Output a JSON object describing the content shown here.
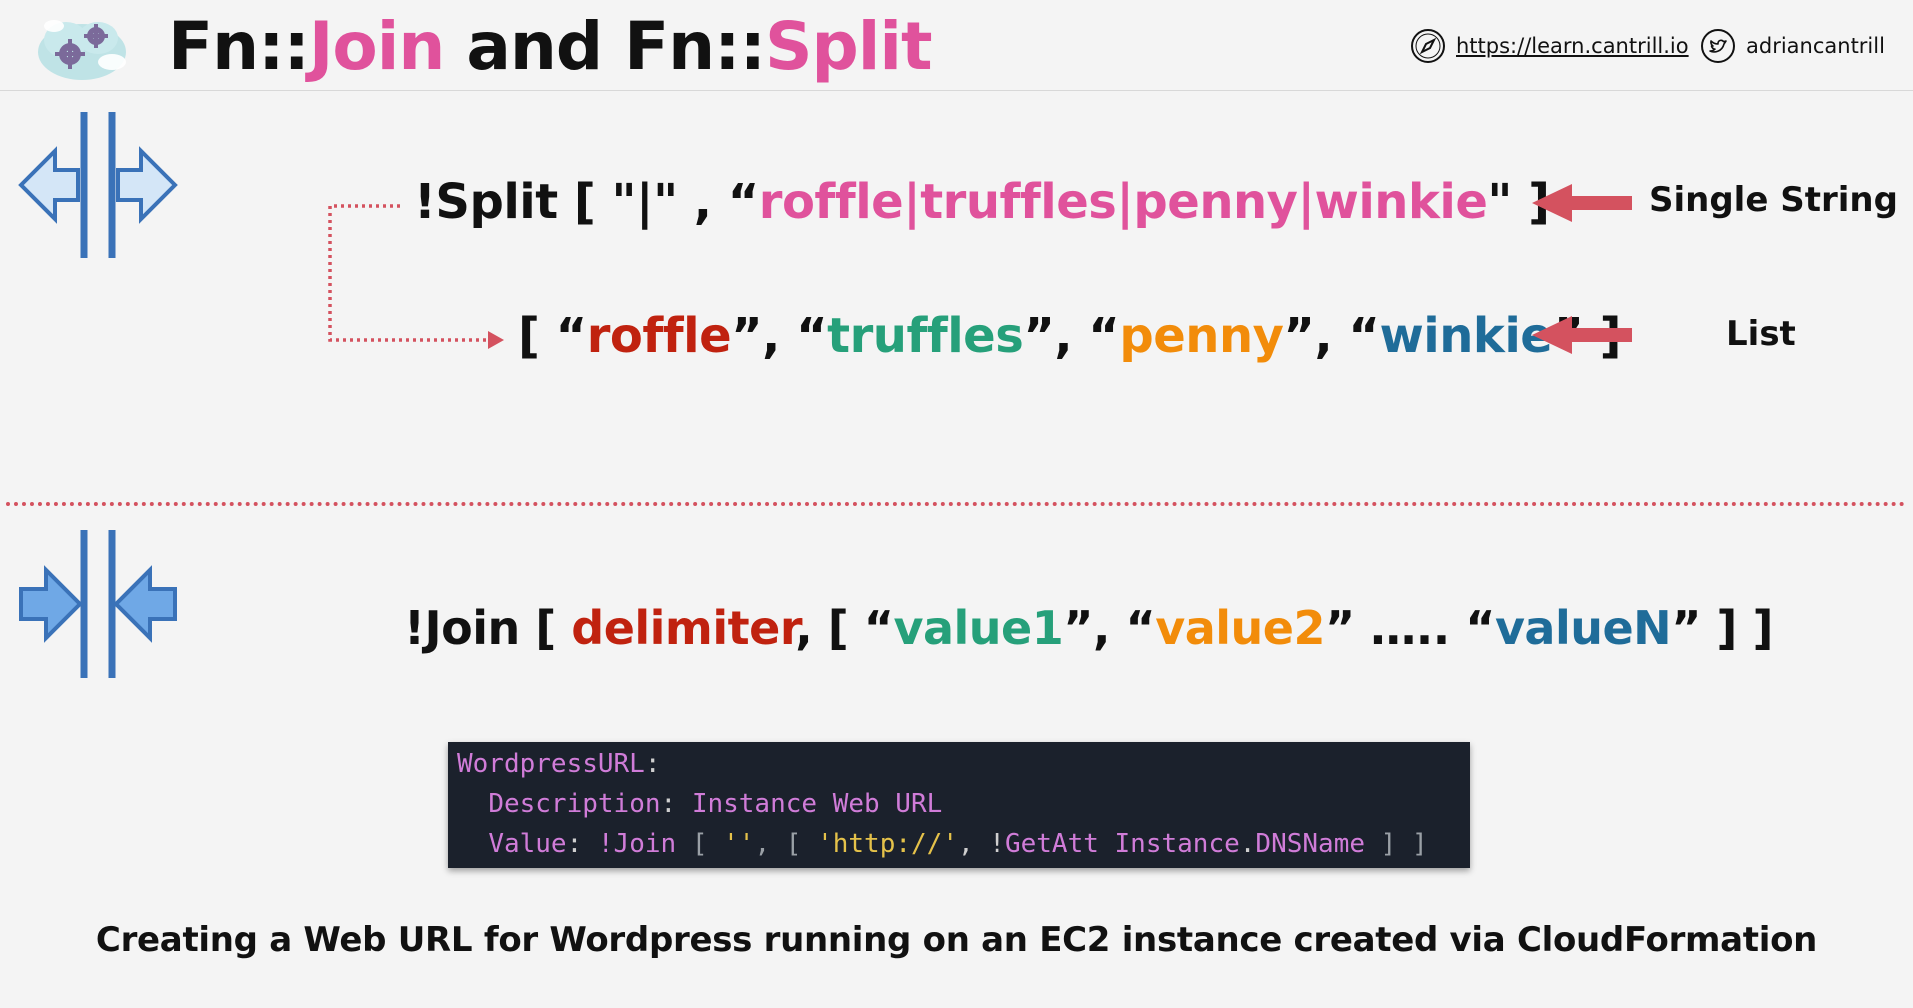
{
  "header": {
    "title_prefix_1": "Fn::",
    "title_join": "Join",
    "title_middle": " and Fn::",
    "title_split": "Split",
    "website_icon": "compass-icon",
    "website": "https://learn.cantrill.io",
    "twitter_icon": "twitter-icon",
    "twitter": "adriancantrill"
  },
  "split_section": {
    "icon": "split-arrows-icon",
    "line1": {
      "prefix": "!Split [ \"|\" , “",
      "value": "roffle|truffles|penny|winkie",
      "suffix": "\" ]"
    },
    "line2": {
      "open": "[ “",
      "items": [
        "roffle",
        "truffles",
        "penny",
        "winkie"
      ],
      "sep": "”, “",
      "close": "” ]"
    },
    "label_single": "Single String",
    "label_list": "List"
  },
  "join_section": {
    "icon": "join-arrows-icon",
    "prefix": "!Join [ ",
    "delimiter": "delimiter",
    "mid1": ", [ “",
    "value1": "value1",
    "mid2": "”, “",
    "value2": "value2",
    "mid3": "” ….. “",
    "valueN": "valueN",
    "suffix": "” ] ]"
  },
  "code": {
    "l1_key": "WordpressURL",
    "l1_colon": ":",
    "l2_indent": "  ",
    "l2_key": "Description",
    "l2_colon": ": ",
    "l2_val": "Instance Web URL",
    "l3_indent": "  ",
    "l3_key": "Value",
    "l3_colon": ": ",
    "l3_join": "!Join",
    "l3_b1": " [ ",
    "l3_empty": "''",
    "l3_b2": ", [ ",
    "l3_http": "'http://'",
    "l3_comma": ", ",
    "l3_bang": "!",
    "l3_getatt": "GetAtt Instance",
    "l3_dot": ".",
    "l3_dns": "DNSName",
    "l3_close": " ] ]"
  },
  "caption": "Creating a Web URL for Wordpress running on an EC2 instance created via CloudFormation",
  "colors": {
    "accent_pink": "#e0529c",
    "red": "#c0220f",
    "green": "#26a07a",
    "orange": "#f28c0a",
    "blue": "#1f6c99",
    "arrow_red": "#d4525f",
    "icon_blue": "#3a72b8"
  }
}
